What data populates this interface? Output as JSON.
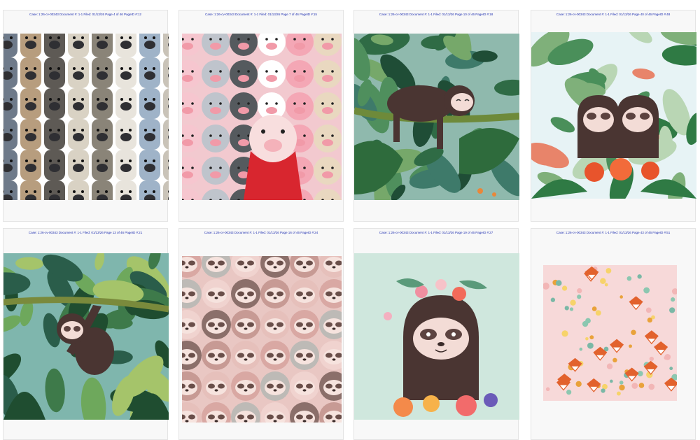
{
  "pages": [
    {
      "header": "Case: 1:26-cv-00343 Document #: 1-1 Filed: 01/13/26 Page 4 of 46 PageID #:12",
      "art": "dogs-pattern"
    },
    {
      "header": "Case: 1:26-cv-00343 Document #: 1-1 Filed: 01/13/26 Page 7 of 46 PageID #:15",
      "art": "pigs-pattern"
    },
    {
      "header": "Case: 1:26-cv-00343 Document #: 1-1 Filed: 01/13/26 Page 10 of 46 PageID #:18",
      "art": "sloth-on-branch-jungle"
    },
    {
      "header": "Case: 1:26-cv-00343 Document #: 1-1 Filed: 01/13/26 Page 40 of 46 PageID #:48",
      "art": "two-sloths-flowers"
    },
    {
      "header": "Case: 1:26-cv-00343 Document #: 1-1 Filed: 01/13/26 Page 13 of 46 PageID #:21",
      "art": "hanging-sloth-jungle"
    },
    {
      "header": "Case: 1:26-cv-00343 Document #: 1-1 Filed: 01/13/26 Page 16 of 46 PageID #:24",
      "art": "sloths-pattern"
    },
    {
      "header": "Case: 1:26-cv-00343 Document #: 1-1 Filed: 01/13/26 Page 19 of 46 PageID #:27",
      "art": "sloth-flower-crown"
    },
    {
      "header": "Case: 1:26-cv-00343 Document #: 1-1 Filed: 01/13/26 Page 43 of 46 PageID #:51",
      "art": "fox-floral-pattern"
    }
  ],
  "colors": {
    "header_text": "#1f2fb0",
    "page_bg": "#f8f8f8",
    "sloth_brown": "#4a3532",
    "sloth_face": "#f3dcd6"
  }
}
